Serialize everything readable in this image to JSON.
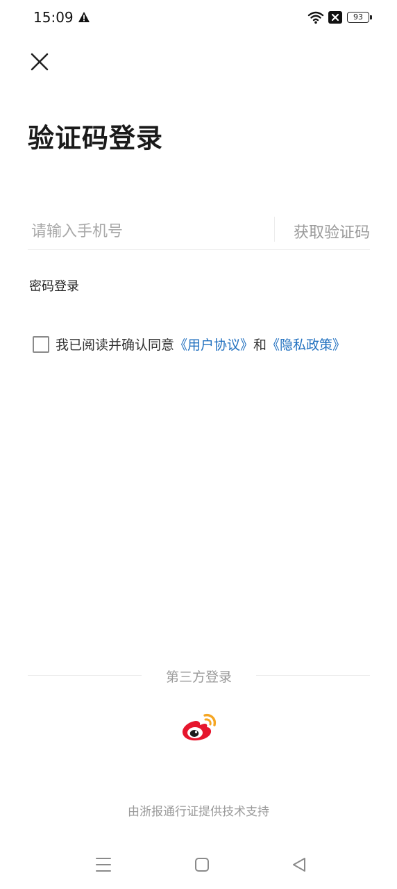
{
  "status_bar": {
    "time": "15:09",
    "battery_level": "93",
    "icons": [
      "warning-icon",
      "wifi-icon",
      "no-sim-icon",
      "battery-icon"
    ]
  },
  "header": {
    "close_icon": "close-icon",
    "title": "验证码登录"
  },
  "form": {
    "phone_placeholder": "请输入手机号",
    "phone_value": "",
    "get_code_label": "获取验证码",
    "password_login_label": "密码登录"
  },
  "agreement": {
    "checked": false,
    "text_prefix": "我已阅读并确认同意",
    "user_agreement_link": "《用户协议》",
    "connector": "和",
    "privacy_policy_link": "《隐私政策》",
    "link_color": "#1f6fbf"
  },
  "third_party": {
    "label": "第三方登录",
    "providers": [
      {
        "name": "weibo",
        "icon": "weibo-icon"
      }
    ]
  },
  "footer": {
    "note": "由浙报通行证提供技术支持"
  },
  "nav_bar": {
    "icons": [
      "menu-icon",
      "home-icon",
      "back-icon"
    ]
  }
}
